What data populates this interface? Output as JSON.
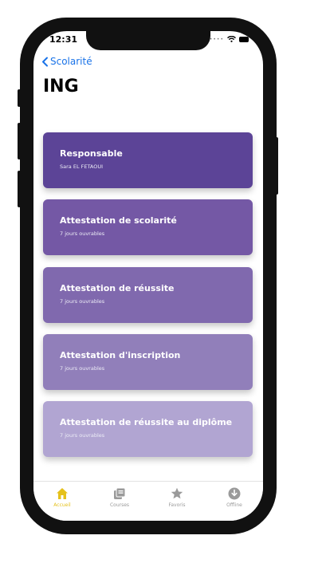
{
  "status_bar": {
    "time": "12:31"
  },
  "nav": {
    "back_label": "Scolarité"
  },
  "page": {
    "title": "ING"
  },
  "cards": [
    {
      "title": "Responsable",
      "subtitle": "Sara EL FETAOUI",
      "color": "#5c4497"
    },
    {
      "title": "Attestation de scolarité",
      "subtitle": "7 jours ouvrables",
      "color": "#7458a5"
    },
    {
      "title": "Attestation de réussite",
      "subtitle": "7 jours ouvrables",
      "color": "#8069ae"
    },
    {
      "title": "Attestation d'inscription",
      "subtitle": "7 jours ouvrables",
      "color": "#917fba"
    },
    {
      "title": "Attestation de réussite au diplôme",
      "subtitle": "7 jours ouvrables",
      "color": "#b1a5d2"
    }
  ],
  "tab_bar": {
    "tabs": [
      {
        "label": "Accueil",
        "icon": "home-icon",
        "active": true
      },
      {
        "label": "Courses",
        "icon": "courses-icon",
        "active": false
      },
      {
        "label": "Favoris",
        "icon": "star-icon",
        "active": false
      },
      {
        "label": "Offline",
        "icon": "download-icon",
        "active": false
      }
    ],
    "active_color": "#e5c11b",
    "inactive_color": "#9a9a9a"
  }
}
